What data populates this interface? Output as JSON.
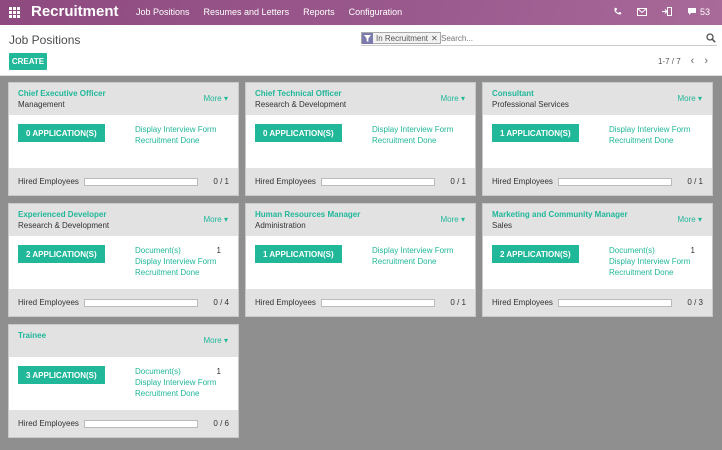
{
  "topbar": {
    "brand": "Recruitment",
    "menu": [
      "Job Positions",
      "Resumes and Letters",
      "Reports",
      "Configuration"
    ],
    "messages_count": "53"
  },
  "control_panel": {
    "title": "Job Positions",
    "facet": "In Recruitment",
    "search_placeholder": "Search...",
    "create_label": "CREATE",
    "pager": "1-7 / 7"
  },
  "common": {
    "more": "More",
    "hired_label": "Hired Employees",
    "documents_label": "Document(s)",
    "interview_label": "Display Interview Form",
    "done_label": "Recruitment Done"
  },
  "jobs": [
    {
      "name": "Chief Executive Officer",
      "dept": "Management",
      "applications": "0 APPLICATION(S)",
      "documents": "",
      "hired": "0 / 1",
      "hired_fraction": 0
    },
    {
      "name": "Chief Technical Officer",
      "dept": "Research & Development",
      "applications": "0 APPLICATION(S)",
      "documents": "",
      "hired": "0 / 1",
      "hired_fraction": 0
    },
    {
      "name": "Consultant",
      "dept": "Professional Services",
      "applications": "1 APPLICATION(S)",
      "documents": "",
      "hired": "0 / 1",
      "hired_fraction": 0
    },
    {
      "name": "Experienced Developer",
      "dept": "Research & Development",
      "applications": "2 APPLICATION(S)",
      "documents": "1",
      "hired": "0 / 4",
      "hired_fraction": 0
    },
    {
      "name": "Human Resources Manager",
      "dept": "Administration",
      "applications": "1 APPLICATION(S)",
      "documents": "",
      "hired": "0 / 1",
      "hired_fraction": 0
    },
    {
      "name": "Marketing and Community Manager",
      "dept": "Sales",
      "applications": "2 APPLICATION(S)",
      "documents": "1",
      "hired": "0 / 3",
      "hired_fraction": 0
    },
    {
      "name": "Trainee",
      "dept": "",
      "applications": "3 APPLICATION(S)",
      "documents": "1",
      "hired": "0 / 6",
      "hired_fraction": 0
    }
  ],
  "colors": {
    "accent": "#21b799",
    "topbar": "#9b5a8e",
    "background": "#8f8f8f"
  }
}
